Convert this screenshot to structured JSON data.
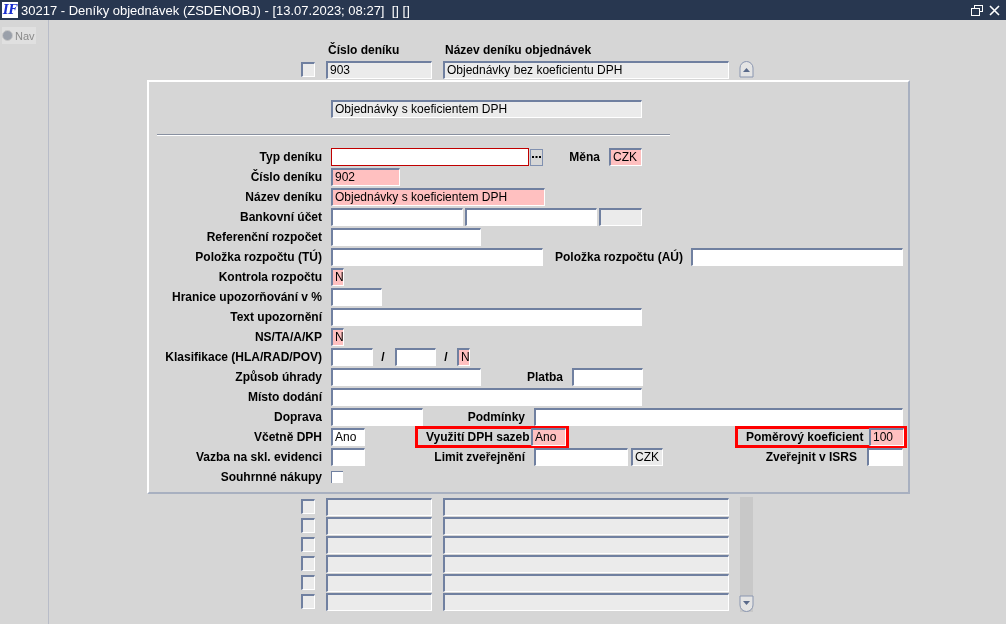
{
  "window": {
    "logo": "IF",
    "title": "30217 - Deníky objednávek (ZSDENOBJ) - [13.07.2023; 08:27]  [] []"
  },
  "nav": {
    "label": "Nav",
    "disabled": true
  },
  "columns": [
    "Číslo deníku",
    "Název deníku objednávek"
  ],
  "record": {
    "number": "903",
    "name": "Objednávky bez koeficientu DPH"
  },
  "dialog": {
    "header_field": {
      "kind": "readonly_field",
      "value": "Objednávky s koeficientem DPH"
    },
    "rows": [
      {
        "label": "Typ deníku",
        "items": [
          {
            "kind": "focused_field"
          },
          {
            "kind": "lov_button"
          },
          {
            "kind": "label",
            "text": "Měna"
          },
          {
            "kind": "required_field",
            "value": "CZK"
          }
        ]
      },
      {
        "label": "Číslo deníku",
        "items": [
          {
            "kind": "required_field",
            "value": "902"
          }
        ]
      },
      {
        "label": "Název deníku",
        "items": [
          {
            "kind": "required_field",
            "value": "Objednávky s koeficientem DPH"
          }
        ]
      },
      {
        "label": "Bankovní účet",
        "items": [
          {
            "kind": "plain_field"
          },
          {
            "kind": "plain_field"
          },
          {
            "kind": "readonly_field"
          }
        ]
      },
      {
        "label": "Referenční rozpočet",
        "items": [
          {
            "kind": "plain_field"
          }
        ]
      },
      {
        "label": "Položka rozpočtu (TÚ)",
        "items": [
          {
            "kind": "plain_field"
          },
          {
            "kind": "label",
            "text": "Položka rozpočtu (AÚ)"
          },
          {
            "kind": "plain_field"
          }
        ]
      },
      {
        "label": "Kontrola rozpočtu",
        "items": [
          {
            "kind": "required_field",
            "value": "N"
          }
        ]
      },
      {
        "label": "Hranice upozorňování v %",
        "items": [
          {
            "kind": "plain_field"
          }
        ]
      },
      {
        "label": "Text upozornění",
        "items": [
          {
            "kind": "plain_field"
          }
        ]
      },
      {
        "label": "NS/TA/A/KP",
        "items": [
          {
            "kind": "required_field",
            "value": "N"
          }
        ]
      },
      {
        "label": "Klasifikace (HLA/RAD/POV)",
        "items": [
          {
            "kind": "plain_field"
          },
          {
            "kind": "separator",
            "text": "/"
          },
          {
            "kind": "plain_field"
          },
          {
            "kind": "separator",
            "text": "/"
          },
          {
            "kind": "required_field",
            "value": "N"
          }
        ]
      },
      {
        "label": "Způsob úhrady",
        "items": [
          {
            "kind": "plain_field"
          },
          {
            "kind": "label",
            "text": "Platba"
          },
          {
            "kind": "plain_field"
          }
        ]
      },
      {
        "label": "Místo dodání",
        "items": [
          {
            "kind": "plain_field"
          }
        ]
      },
      {
        "label": "Doprava",
        "items": [
          {
            "kind": "plain_field"
          },
          {
            "kind": "label",
            "text": "Podmínky"
          },
          {
            "kind": "plain_field"
          }
        ]
      },
      {
        "label": "Včetně DPH",
        "items": [
          {
            "kind": "plain_field",
            "value": "Ano"
          },
          {
            "kind": "group",
            "highlighted": true,
            "label": "Využití DPH sazeb",
            "field": {
              "kind": "required_field",
              "value": "Ano"
            }
          },
          {
            "kind": "group",
            "highlighted": true,
            "label": "Poměrový koeficient",
            "field": {
              "kind": "required_field",
              "value": "100"
            }
          }
        ]
      },
      {
        "label": "Vazba na skl. evidenci",
        "items": [
          {
            "kind": "plain_field"
          },
          {
            "kind": "label",
            "text": "Limit zveřejnění"
          },
          {
            "kind": "plain_field"
          },
          {
            "kind": "readonly_field",
            "value": "CZK"
          },
          {
            "kind": "label",
            "text": "Zveřejnit v ISRS"
          },
          {
            "kind": "plain_field"
          }
        ]
      },
      {
        "label": "Souhrnné nákupy",
        "items": [
          {
            "kind": "checkbox",
            "checked": false
          }
        ]
      }
    ]
  }
}
